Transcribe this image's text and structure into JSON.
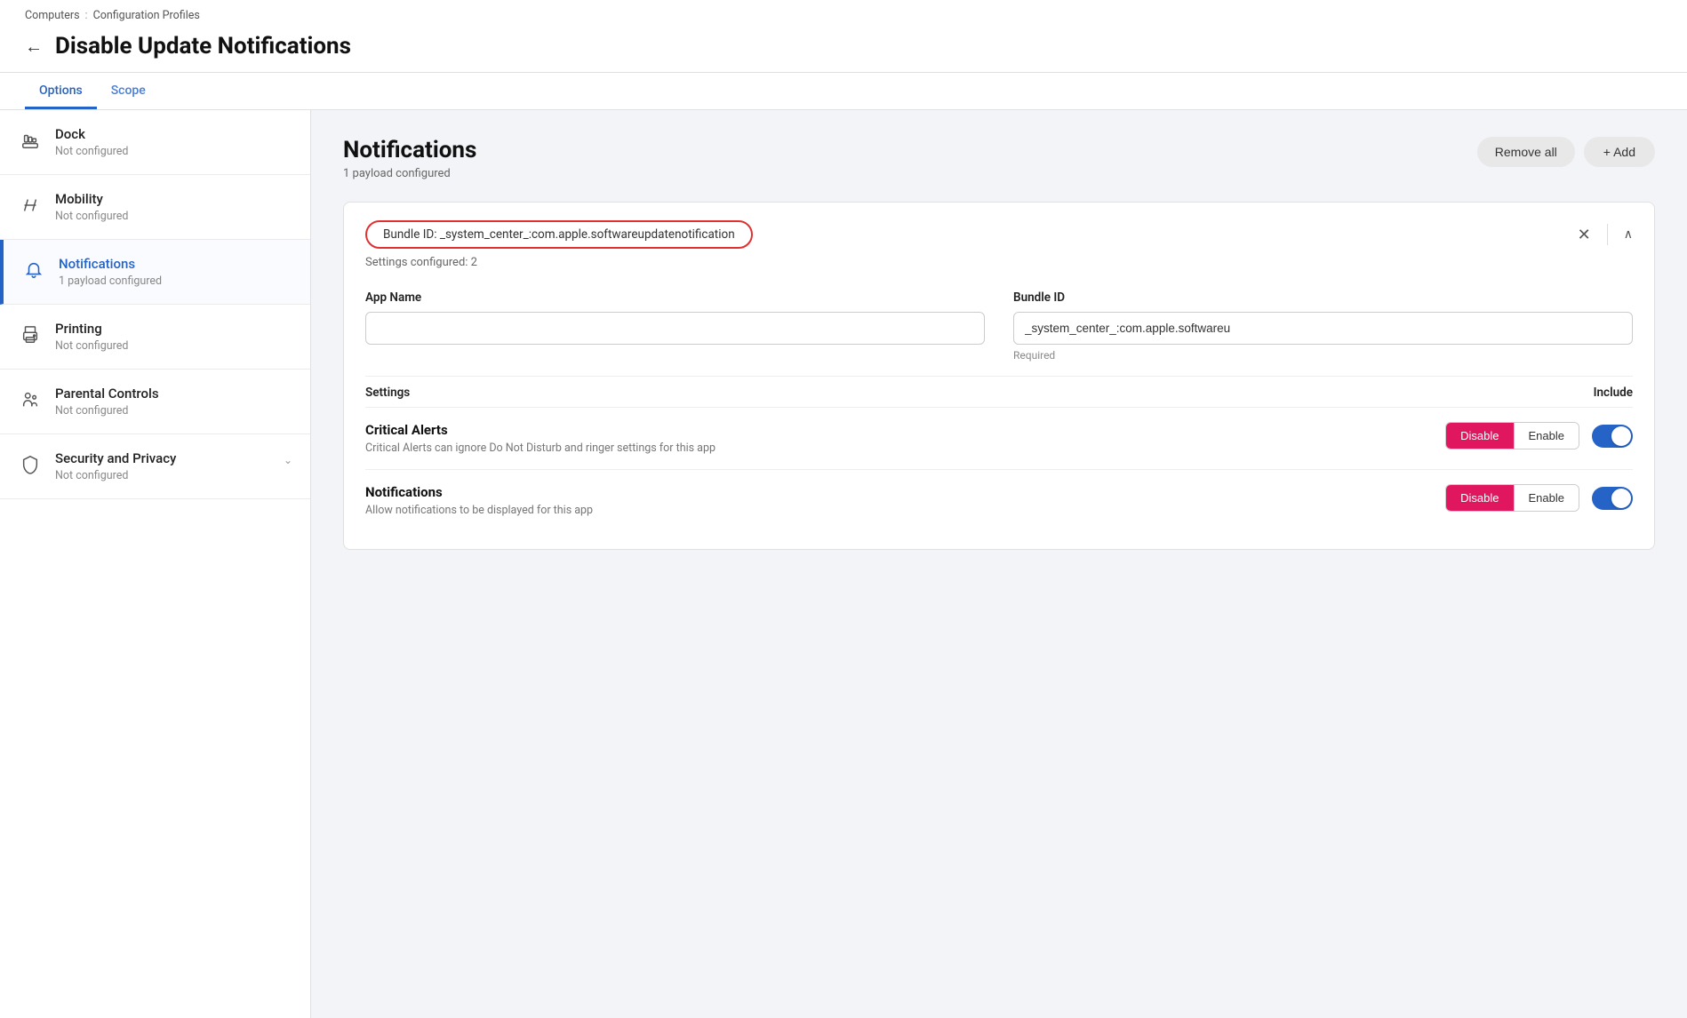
{
  "breadcrumb": {
    "computers": "Computers",
    "separator": ":",
    "config_profiles": "Configuration Profiles"
  },
  "header": {
    "back_label": "←",
    "title": "Disable Update Notifications"
  },
  "tabs": [
    {
      "id": "options",
      "label": "Options",
      "active": true
    },
    {
      "id": "scope",
      "label": "Scope",
      "active": false
    }
  ],
  "sidebar": {
    "items": [
      {
        "id": "dock",
        "title": "Dock",
        "subtitle": "Not configured",
        "active": false,
        "icon": "dock-icon",
        "has_chevron": false
      },
      {
        "id": "mobility",
        "title": "Mobility",
        "subtitle": "Not configured",
        "active": false,
        "icon": "mobility-icon",
        "has_chevron": false
      },
      {
        "id": "notifications",
        "title": "Notifications",
        "subtitle": "1 payload configured",
        "active": true,
        "icon": "notifications-icon",
        "has_chevron": false
      },
      {
        "id": "printing",
        "title": "Printing",
        "subtitle": "Not configured",
        "active": false,
        "icon": "printing-icon",
        "has_chevron": false
      },
      {
        "id": "parental-controls",
        "title": "Parental Controls",
        "subtitle": "Not configured",
        "active": false,
        "icon": "parental-controls-icon",
        "has_chevron": false
      },
      {
        "id": "security-privacy",
        "title": "Security and Privacy",
        "subtitle": "Not configured",
        "active": false,
        "icon": "security-icon",
        "has_chevron": true
      }
    ]
  },
  "content": {
    "section_title": "Notifications",
    "section_subtitle": "1 payload configured",
    "remove_all_label": "Remove all",
    "add_label": "+ Add",
    "bundle": {
      "bundle_id_display": "Bundle ID: _system_center_:com.apple.softwareupdatenotification",
      "settings_count": "Settings configured: 2",
      "close_icon": "✕",
      "chevron_up": "∧"
    },
    "form": {
      "app_name_label": "App Name",
      "app_name_value": "",
      "app_name_placeholder": "",
      "bundle_id_label": "Bundle ID",
      "bundle_id_value": "_system_center_:com.apple.softwareu",
      "bundle_id_placeholder": "",
      "required_text": "Required"
    },
    "settings_col": "Settings",
    "include_col": "Include",
    "settings_rows": [
      {
        "id": "critical-alerts",
        "title": "Critical Alerts",
        "description": "Critical Alerts can ignore Do Not Disturb and ringer settings for this app",
        "state": "Disable",
        "toggle_on": true
      },
      {
        "id": "notifications",
        "title": "Notifications",
        "description": "Allow notifications to be displayed for this app",
        "state": "Disable",
        "toggle_on": true
      }
    ]
  }
}
